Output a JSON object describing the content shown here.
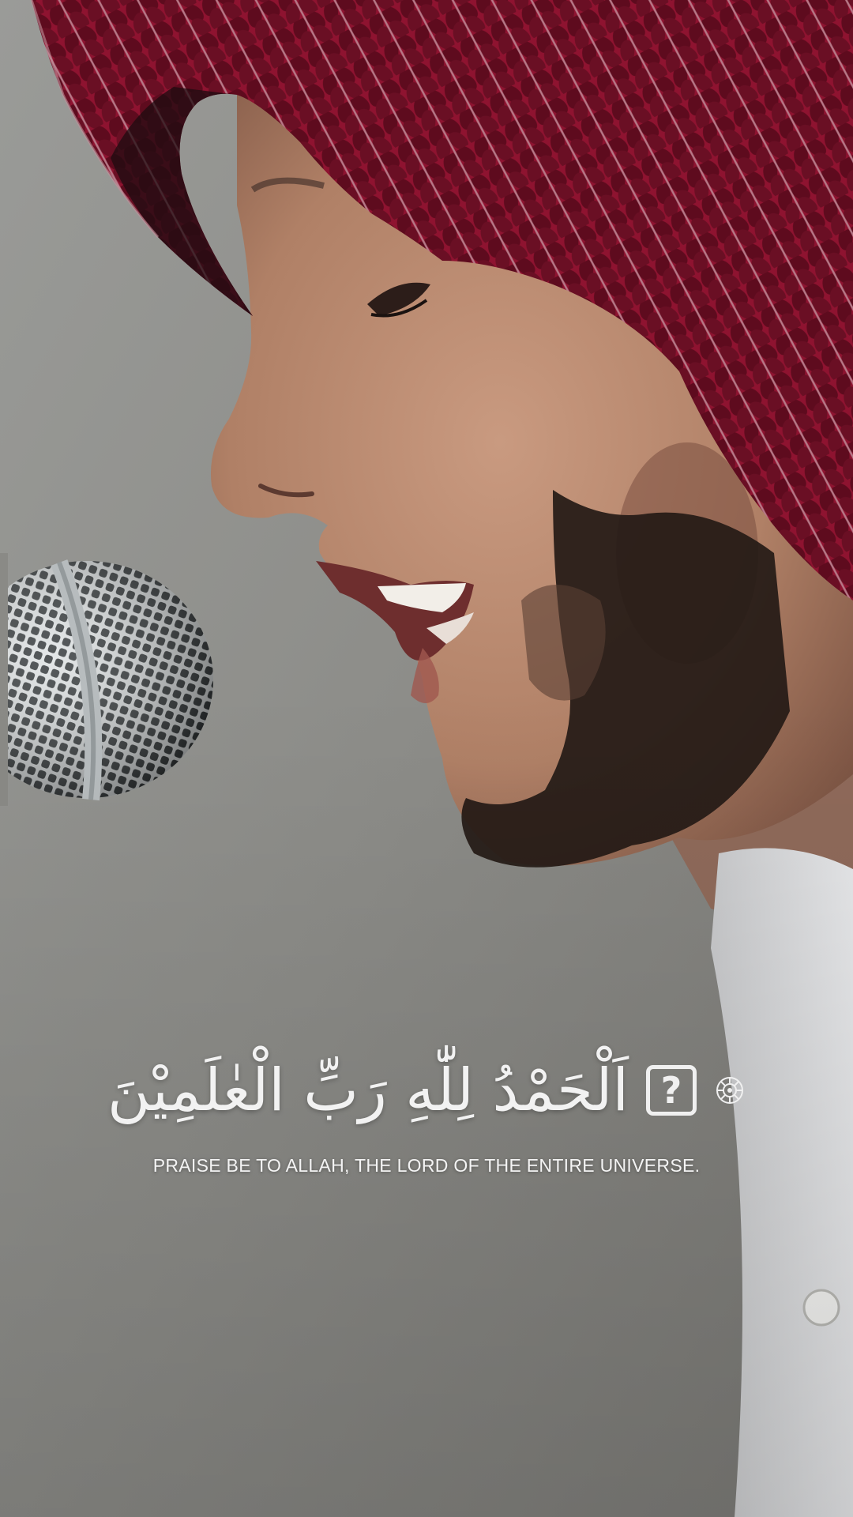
{
  "video_frame": {
    "arabic_verse": "اَلْحَمْدُ لِلّٰهِ رَبِّ الْعٰلَمِيْنَ",
    "missing_glyph": "?",
    "translation": "PRAISE BE TO ALLAH, THE LORD OF THE ENTIRE UNIVERSE.",
    "ayah_marker_icon": "ayah-end-ornament",
    "colors": {
      "background": "#8a8a86",
      "keffiyeh_red": "#8e1330",
      "skin": "#b98a72",
      "beard": "#241a16",
      "caption_text": "#f2f2f2"
    }
  }
}
